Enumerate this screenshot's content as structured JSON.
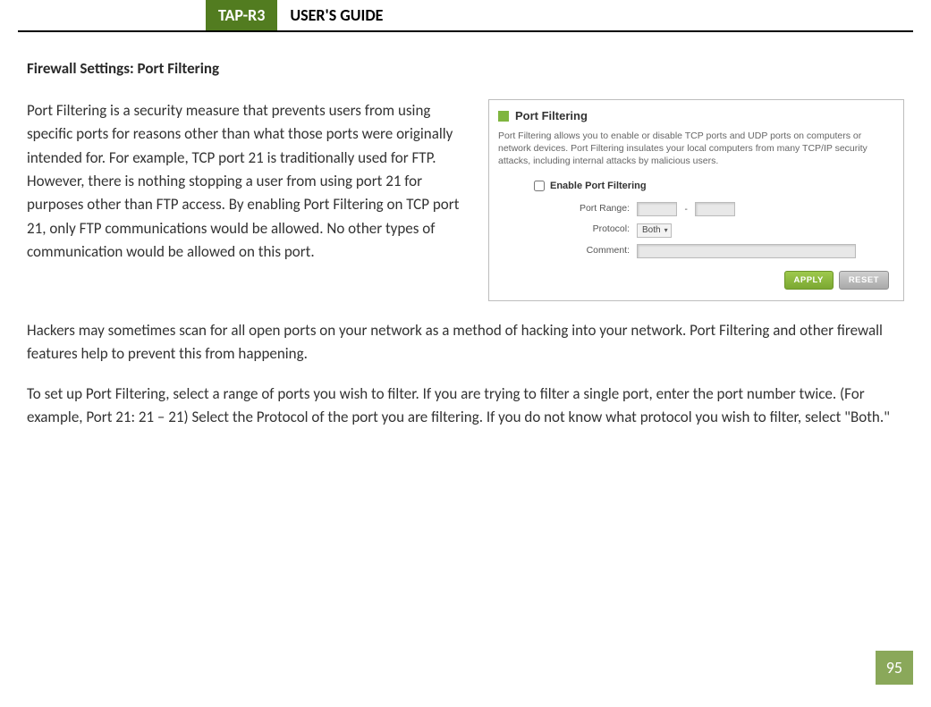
{
  "header": {
    "model": "TAP-R3",
    "title": "USER'S GUIDE"
  },
  "section_title": "Firewall Settings: Port Filtering",
  "paragraphs": {
    "p1": "Port Filtering is a security measure that prevents users from using specific ports for reasons other than what those ports were originally intended for.  For example, TCP port 21 is traditionally used for FTP.  However, there is nothing stopping a user from using port 21 for purposes other than FTP access.  By enabling Port Filtering on TCP port 21, only FTP communications would be allowed.  No other types of communication would be allowed on this port.",
    "p2": "Hackers may sometimes scan for all open ports on your network as a method of hacking into your network.  Port Filtering and other firewall features help to prevent this from happening.",
    "p3": "To set up Port Filtering, select a range of ports you wish to filter.  If you are trying to filter a single port, enter the port number twice.  (For example, Port 21:  21 – 21) Select the Protocol of the port you are filtering.  If you do not know what protocol you wish to filter, select \"Both.\""
  },
  "panel": {
    "title": "Port Filtering",
    "description": "Port Filtering allows you to enable or disable TCP ports and UDP ports on computers or network devices. Port Filtering insulates your local computers from many TCP/IP security attacks, including internal attacks by malicious users.",
    "enable_label": "Enable Port Filtering",
    "fields": {
      "port_range_label": "Port Range:",
      "port_range_dash": "-",
      "protocol_label": "Protocol:",
      "protocol_value": "Both",
      "comment_label": "Comment:"
    },
    "buttons": {
      "apply": "APPLY",
      "reset": "RESET"
    }
  },
  "page_number": "95"
}
